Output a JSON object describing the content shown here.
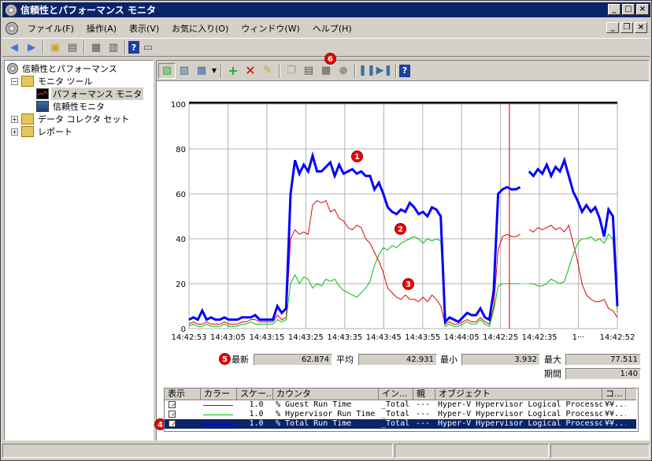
{
  "window": {
    "title": "信頼性とパフォーマンス モニタ"
  },
  "menu": [
    "ファイル(F)",
    "操作(A)",
    "表示(V)",
    "お気に入り(O)",
    "ウィンドウ(W)",
    "ヘルプ(H)"
  ],
  "tree": {
    "root": "信頼性とパフォーマンス",
    "monitor_tools": "モニタ ツール",
    "perf_monitor": "パフォーマンス モニタ",
    "rel_monitor": "信頼性モニタ",
    "collector_sets": "データ コレクタ セット",
    "reports": "レポート"
  },
  "badges": {
    "b1": "1",
    "b2": "2",
    "b3": "3",
    "b4": "4",
    "b5": "5",
    "b6": "6"
  },
  "stats": {
    "last_label": "最新",
    "last_value": "62.874",
    "avg_label": "平均",
    "avg_value": "42.931",
    "min_label": "最小",
    "min_value": "3.932",
    "max_label": "最大",
    "max_value": "77.511",
    "duration_label": "期間",
    "duration_value": "1:40"
  },
  "table": {
    "headers": [
      "表示",
      "カラー",
      "スケー...",
      "カウンタ",
      "イン...",
      "親",
      "オブジェクト",
      "コ..."
    ],
    "rows": [
      {
        "check": "✓",
        "color": "#e00000",
        "scale": "1.0",
        "counter": "% Guest Run Time",
        "instance": "_Total",
        "parent": "---",
        "object": "Hyper-V Hypervisor Logical Processor",
        "computer": "¥¥..."
      },
      {
        "check": "✓",
        "color": "#00c000",
        "scale": "1.0",
        "counter": "% Hypervisor Run Time",
        "instance": "_Total",
        "parent": "---",
        "object": "Hyper-V Hypervisor Logical Processor",
        "computer": "¥¥..."
      },
      {
        "check": "✓",
        "color": "#0000ff",
        "scale": "1.0",
        "counter": "% Total Run Time",
        "instance": "_Total",
        "parent": "---",
        "object": "Hyper-V Hypervisor Logical Processor",
        "computer": "¥¥..."
      }
    ]
  },
  "chart_data": {
    "type": "line",
    "ylim": [
      0,
      100
    ],
    "yticks": [
      0,
      20,
      40,
      60,
      80,
      100
    ],
    "xticks": [
      "14:42:53",
      "14:43:05",
      "14:43:15",
      "14:43:25",
      "14:43:35",
      "14:43:45",
      "14:43:55",
      "14:44:05",
      "14:42:25",
      "14:42:35",
      "1···",
      "14:42:52"
    ],
    "grid": true,
    "series": [
      {
        "name": "% Guest Run Time",
        "color": "#e00000",
        "values": [
          2,
          3,
          2,
          2,
          3,
          2,
          2,
          2,
          3,
          2,
          2,
          2,
          3,
          3,
          4,
          4,
          3,
          3,
          3,
          3,
          6,
          4,
          5,
          40,
          44,
          42,
          43,
          42,
          55,
          57,
          56,
          57,
          52,
          53,
          49,
          48,
          45,
          44,
          46,
          45,
          40,
          38,
          34,
          30,
          25,
          18,
          16,
          14,
          13,
          15,
          13,
          13,
          12,
          14,
          12,
          15,
          13,
          10,
          2,
          3,
          2,
          2,
          3,
          4,
          3,
          3,
          5,
          3,
          2,
          10,
          35,
          41,
          42,
          41,
          41,
          42,
          null,
          44,
          43,
          45,
          44,
          45,
          46,
          44,
          45,
          43,
          46,
          38,
          30,
          20,
          15,
          13,
          12,
          12,
          13,
          9,
          8,
          5
        ]
      },
      {
        "name": "% Hypervisor Run Time",
        "color": "#00c000",
        "values": [
          1,
          2,
          1,
          1,
          2,
          1,
          1,
          1,
          2,
          1,
          1,
          1,
          2,
          2,
          3,
          2,
          2,
          2,
          2,
          2,
          4,
          3,
          4,
          20,
          24,
          20,
          23,
          22,
          18,
          20,
          19,
          22,
          21,
          22,
          19,
          17,
          16,
          15,
          14,
          16,
          18,
          21,
          28,
          33,
          36,
          35,
          37,
          36,
          38,
          39,
          40,
          41,
          40,
          38,
          40,
          39,
          40,
          39,
          1,
          2,
          1,
          1,
          2,
          3,
          2,
          2,
          4,
          2,
          1,
          8,
          19,
          20,
          20,
          20,
          20,
          20,
          null,
          20,
          20,
          19,
          19,
          20,
          22,
          21,
          20,
          21,
          27,
          33,
          38,
          40,
          40,
          41,
          39,
          40,
          38,
          42,
          40,
          7
        ]
      },
      {
        "name": "% Total Run Time",
        "color": "#0000ff",
        "values": [
          4,
          5,
          4,
          8,
          4,
          5,
          4,
          4,
          5,
          4,
          4,
          4,
          5,
          5,
          5,
          6,
          4,
          4,
          4,
          4,
          10,
          7,
          9,
          60,
          75,
          69,
          73,
          70,
          77,
          70,
          70,
          72,
          74,
          68,
          73,
          69,
          70,
          71,
          69,
          70,
          68,
          68,
          62,
          65,
          60,
          54,
          52,
          51,
          53,
          52,
          56,
          54,
          51,
          52,
          50,
          54,
          53,
          50,
          3,
          5,
          4,
          3,
          5,
          7,
          6,
          6,
          9,
          5,
          4,
          17,
          60,
          62,
          63,
          62,
          62,
          63,
          null,
          70,
          68,
          71,
          69,
          73,
          68,
          72,
          70,
          75,
          68,
          61,
          57,
          52,
          55,
          52,
          54,
          49,
          41,
          53,
          50,
          10
        ]
      }
    ]
  }
}
